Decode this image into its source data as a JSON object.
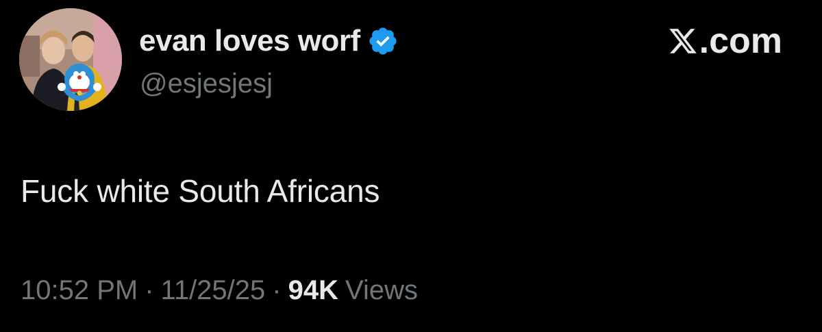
{
  "user": {
    "display_name": "evan loves worf",
    "handle": "@esjesjesj",
    "verified": true,
    "avatar_alt": "profile-photo"
  },
  "site": {
    "logo_icon": "x-logo-icon",
    "suffix": ".com"
  },
  "tweet": {
    "text": "Fuck white South Africans",
    "time": "10:52 PM",
    "separator": "·",
    "date": "11/25/25",
    "views_count": "94K",
    "views_label": "Views"
  },
  "colors": {
    "background": "#000000",
    "primary_text": "#e7e9ea",
    "secondary_text": "#71767b",
    "verified_badge": "#1d9bf0"
  }
}
